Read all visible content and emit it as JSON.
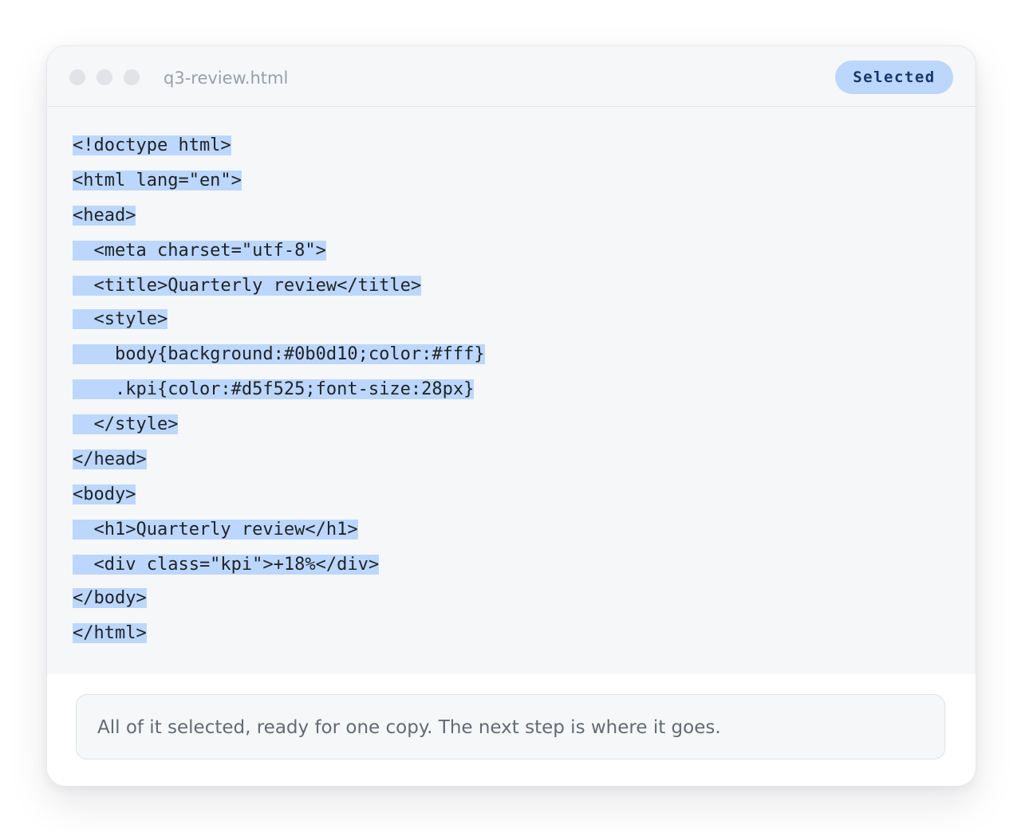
{
  "window": {
    "filename": "q3-review.html",
    "badge": "Selected"
  },
  "code": {
    "lines": [
      "<!doctype html>",
      "<html lang=\"en\">",
      "<head>",
      "  <meta charset=\"utf-8\">",
      "  <title>Quarterly review</title>",
      "  <style>",
      "    body{background:#0b0d10;color:#fff}",
      "    .kpi{color:#d5f525;font-size:28px}",
      "  </style>",
      "</head>",
      "<body>",
      "  <h1>Quarterly review</h1>",
      "  <div class=\"kpi\">+18%</div>",
      "</body>",
      "</html>"
    ]
  },
  "footer": {
    "note": "All of it selected, ready for one copy. The next step is where it goes."
  },
  "colors": {
    "selection": "#bcd7fb",
    "badge_text": "#16386b",
    "panel_bg": "#f6f7f9"
  },
  "icons": [
    "window-dot-icon",
    "window-dot-icon",
    "window-dot-icon"
  ]
}
